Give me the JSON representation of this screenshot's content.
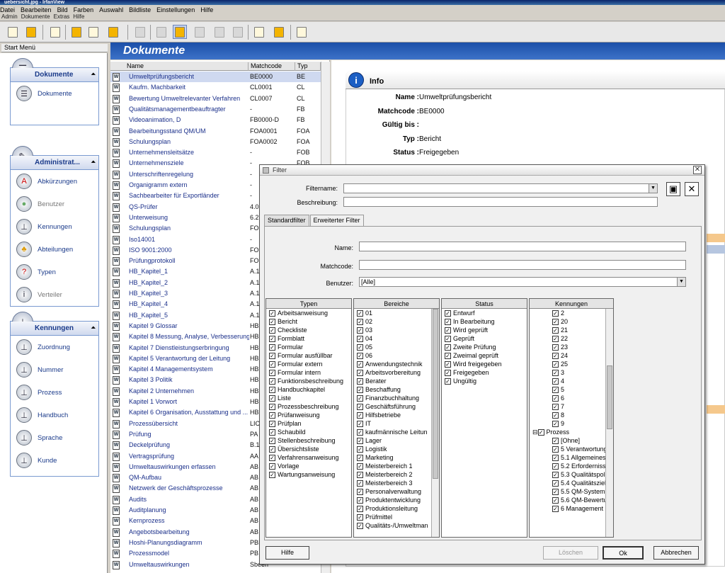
{
  "window": {
    "title": "uebersicht.jpg - IrfanView"
  },
  "menu": {
    "row1": [
      "Datei",
      "Bearbeiten",
      "Bild",
      "Farben",
      "Auswahl",
      "Bildliste",
      "Einstellungen",
      "Hilfe"
    ],
    "row2": [
      "Admin",
      "Dokumente",
      "Extras",
      "Hilfe"
    ]
  },
  "start_menu": {
    "label": "Start Menü",
    "groups": [
      {
        "title": "Dokumente",
        "items": [
          "Dokumente"
        ]
      },
      {
        "title": "Administrat...",
        "items": [
          "Abkürzungen",
          "Benutzer",
          "Kennungen",
          "Abteilungen",
          "Typen",
          "Verteiler"
        ]
      },
      {
        "title": "Kennungen",
        "items": [
          "Zuordnung",
          "Nummer",
          "Prozess",
          "Handbuch",
          "Sprache",
          "Kunde"
        ]
      }
    ]
  },
  "documents": {
    "title": "Dokumente",
    "columns": [
      "Name",
      "Matchcode",
      "Typ"
    ],
    "rows": [
      [
        "Umweltprüfungsbericht",
        "BE0000",
        "BE"
      ],
      [
        "Kaufm. Machbarkeit",
        "CL0001",
        "CL"
      ],
      [
        "Bewertung Umweltrelevanter Verfahren",
        "CL0007",
        "CL"
      ],
      [
        "Qualitätsmanagementbeauftragter",
        "-",
        "FB"
      ],
      [
        "Videoanimation, D",
        "FB0000-D",
        "FB"
      ],
      [
        "Bearbeitungsstand QM/UM",
        "FOA0001",
        "FOA"
      ],
      [
        "Schulungsplan",
        "FOA0002",
        "FOA"
      ],
      [
        "Unternehmensleitsätze",
        "-",
        "FOB"
      ],
      [
        "Unternehmensziele",
        "-",
        "FOB"
      ],
      [
        "Unterschriftenregelung",
        "-",
        ""
      ],
      [
        "Organigramm extern",
        "-",
        ""
      ],
      [
        "Sachbearbeiter für Exportländer",
        "-",
        ""
      ],
      [
        "QS-Prüfer",
        "4.0",
        ""
      ],
      [
        "Unterweisung",
        "6.2",
        ""
      ],
      [
        "Schulungsplan",
        "FO",
        ""
      ],
      [
        "Iso14001",
        "-",
        ""
      ],
      [
        "ISO 9001:2000",
        "FO",
        ""
      ],
      [
        "Prüfungprotokoll",
        "FO",
        ""
      ],
      [
        "HB_Kapitel_1",
        "A.1",
        ""
      ],
      [
        "HB_Kapitel_2",
        "A.1",
        ""
      ],
      [
        "HB_Kapitel_3",
        "A.1",
        ""
      ],
      [
        "HB_Kapitel_4",
        "A.1",
        ""
      ],
      [
        "HB_Kapitel_5",
        "A.1",
        ""
      ],
      [
        "Kapitel 9 Glossar",
        "HB",
        ""
      ],
      [
        "Kapitel 8 Messung, Analyse, Verbesserung",
        "HB",
        ""
      ],
      [
        "Kapitel 7 Dienstleistungserbringung",
        "HB",
        ""
      ],
      [
        "Kapitel 5 Verantwortung der Leitung",
        "HB",
        ""
      ],
      [
        "Kapitel 4 Managementsystem",
        "HB",
        ""
      ],
      [
        "Kapitel 3 Politik",
        "HB",
        ""
      ],
      [
        "Kapitel 2 Unternehmen",
        "HB",
        ""
      ],
      [
        "Kapitel 1 Vorwort",
        "HB",
        ""
      ],
      [
        "Kapitel 6 Organisation, Ausstattung und ...",
        "HB",
        ""
      ],
      [
        "Prozessübersicht",
        "LIC",
        ""
      ],
      [
        "Prüfung",
        "PA",
        ""
      ],
      [
        "Deckelprüfung",
        "B.1",
        ""
      ],
      [
        "Vertragsprüfung",
        "AA",
        ""
      ],
      [
        "Umweltauswirkungen erfassen",
        "AB",
        ""
      ],
      [
        "QM-Aufbau",
        "AB",
        ""
      ],
      [
        "Netzwerk der Geschäftsprozesse",
        "AB",
        ""
      ],
      [
        "Audits",
        "AB",
        ""
      ],
      [
        "Auditplanung",
        "AB",
        ""
      ],
      [
        "Kernprozess",
        "AB",
        ""
      ],
      [
        "Angebotsbearbeitung",
        "AB",
        ""
      ],
      [
        "Hoshi-Planungsdiagramm",
        "PBI",
        ""
      ],
      [
        "Prozessmodel",
        "PB",
        ""
      ],
      [
        "Umweltauswirkungen",
        "Sbeen",
        ""
      ]
    ]
  },
  "info": {
    "title": "Info",
    "fields": [
      {
        "label": "Name :",
        "value": "Umweltprüfungsbericht"
      },
      {
        "label": "Matchcode :",
        "value": "BE0000"
      },
      {
        "label": "Gültig bis :",
        "value": ""
      },
      {
        "label": "Typ :",
        "value": "Bericht"
      },
      {
        "label": "Status :",
        "value": "Freigegeben"
      }
    ]
  },
  "filter": {
    "title": "Filter",
    "filtername_label": "Filtername:",
    "filtername_value": "",
    "beschreibung_label": "Beschreibung:",
    "beschreibung_value": "",
    "tabs": [
      "Standardfilter",
      "Erweiterter Filter"
    ],
    "name_label": "Name:",
    "matchcode_label": "Matchcode:",
    "benutzer_label": "Benutzer:",
    "benutzer_value": "[Alle]",
    "lists": {
      "typen": {
        "title": "Typen",
        "items": [
          "Arbeitsanweisung",
          "Bericht",
          "Checkliste",
          "Formblatt",
          "Formular",
          "Formular ausfüllbar",
          "Formular extern",
          "Formular intern",
          "Funktionsbeschreibung",
          "Handbuchkapitel",
          "Liste",
          "Prozessbeschreibung",
          "Prüfanweisung",
          "Prüfplan",
          "Schaubild",
          "Stellenbeschreibung",
          "Übersichtsliste",
          "Verfahrensanweisung",
          "Vorlage",
          "Wartungsanweisung"
        ]
      },
      "bereiche": {
        "title": "Bereiche",
        "items": [
          "01",
          "02",
          "03",
          "04",
          "05",
          "06",
          "Anwendungstechnik",
          "Arbeitsvorbereitung",
          "Berater",
          "Beschaffung",
          "Finanzbuchhaltung",
          "Geschäftsführung",
          "Hilfsbetriebe",
          "IT",
          "kaufmännische Leitun",
          "Lager",
          "Logistik",
          "Marketing",
          "Meisterbereich 1",
          "Meisterbereich 2",
          "Meisterbereich 3",
          "Personalverwaltung",
          "Produktentwicklung",
          "Produktionsleitung",
          "Prüfmittel",
          "Qualitäts-/Umweltman"
        ]
      },
      "status": {
        "title": "Status",
        "items": [
          "Entwurf",
          "In Bearbeitung",
          "Wird geprüft",
          "Geprüft",
          "Zweite Prüfung",
          "Zweimal geprüft",
          "Wird freigegeben",
          "Freigegeben",
          "Ungültig"
        ]
      },
      "kennungen": {
        "title": "Kennungen",
        "items": [
          "2",
          "20",
          "21",
          "22",
          "23",
          "24",
          "25",
          "3",
          "4",
          "5",
          "6",
          "7",
          "8",
          "9"
        ],
        "group": "Prozess",
        "subitems": [
          "[Ohne]",
          "5 Verantwortung",
          "5.1 Allgemeines",
          "5.2 Erfordernisse",
          "5.3 Qualitätspoli",
          "5.4 Qualitätsziel",
          "5.5 QM-System",
          "5.6 QM-Bewertu",
          "6 Management"
        ]
      }
    },
    "buttons": {
      "help": "Hilfe",
      "delete": "Löschen",
      "ok": "Ok",
      "cancel": "Abbrechen"
    }
  }
}
